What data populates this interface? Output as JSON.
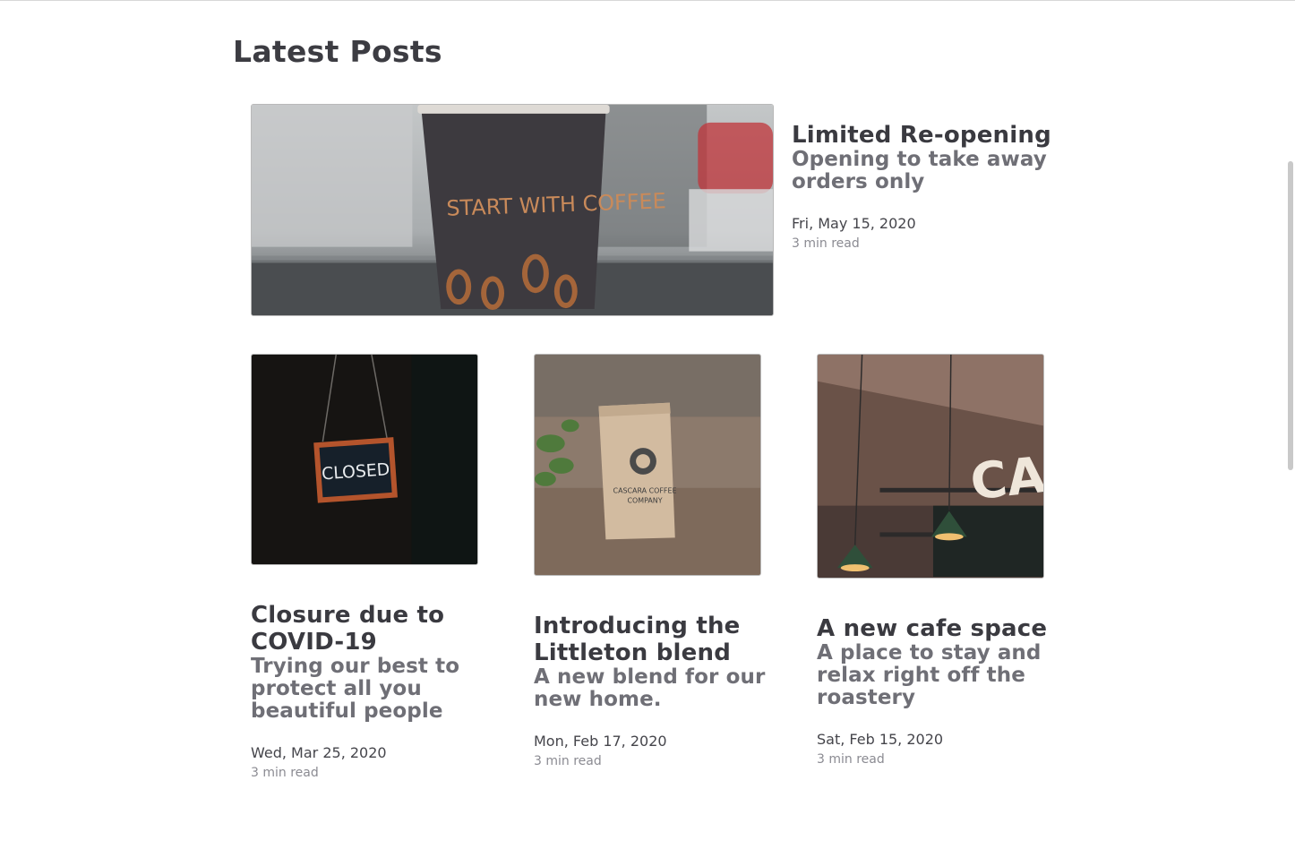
{
  "page": {
    "title": "Latest Posts"
  },
  "featured": {
    "title": "Limited Re-opening",
    "subtitle": "Opening to take away orders only",
    "date": "Fri, May 15, 2020",
    "read_time": "3 min read",
    "image_text": "START WITH COFFEE"
  },
  "posts": [
    {
      "title": "Closure due to COVID-19",
      "subtitle": "Trying our best to protect all you beautiful people",
      "date": "Wed, Mar 25, 2020",
      "read_time": "3 min read",
      "image_text": "CLOSED"
    },
    {
      "title": "Introducing the Littleton blend",
      "subtitle": "A new blend for our new home.",
      "date": "Mon, Feb 17, 2020",
      "read_time": "3 min read",
      "image_text_line1": "CASCARA COFFEE",
      "image_text_line2": "COMPANY"
    },
    {
      "title": "A new cafe space",
      "subtitle": "A place to stay and relax right off the roastery",
      "date": "Sat, Feb 15, 2020",
      "read_time": "3 min read",
      "image_text": "CA"
    }
  ]
}
